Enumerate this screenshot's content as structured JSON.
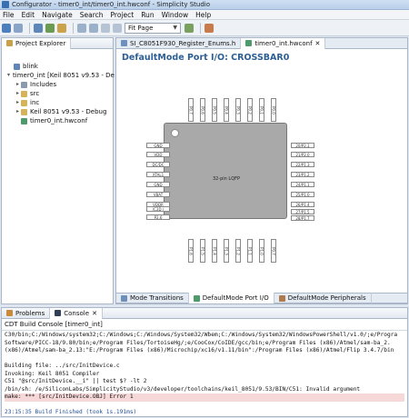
{
  "window": {
    "title": "Configurator - timer0_int/timer0_int.hwconf - Simplicity Studio"
  },
  "menu": [
    "File",
    "Edit",
    "Navigate",
    "Search",
    "Project",
    "Run",
    "Window",
    "Help"
  ],
  "toolbar": {
    "zoom_value": "Fit Page"
  },
  "project_explorer": {
    "tab_label": "Project Explorer",
    "items": [
      {
        "label": "blink",
        "level": 0,
        "expanded": false
      },
      {
        "label": "timer0_int [Keil 8051 v9.53 - De",
        "level": 0,
        "expanded": true
      },
      {
        "label": "Includes",
        "level": 1,
        "expanded": false
      },
      {
        "label": "src",
        "level": 1,
        "expanded": false
      },
      {
        "label": "inc",
        "level": 1,
        "expanded": false
      },
      {
        "label": "Keil 8051 v9.53 - Debug",
        "level": 1,
        "expanded": false
      },
      {
        "label": "timer0_int.hwconf",
        "level": 1,
        "expanded": null
      }
    ]
  },
  "editor": {
    "tabs": [
      {
        "label": "SI_C8051F930_Register_Enums.h",
        "active": false
      },
      {
        "label": "timer0_int.hwconf",
        "active": true
      }
    ],
    "title": "DefaultMode Port I/O: CROSSBAR0",
    "chip_label": "32-pin LQFP",
    "top_pins": [
      "P0.7",
      "P0.6",
      "P0.5",
      "P0.4",
      "P0.3",
      "P0.2",
      "P0.1",
      "P0.0"
    ],
    "bottom_pins": [
      "P1.6",
      "P1.5",
      "P1.4",
      "P1.3",
      "P1.2",
      "P1.1",
      "P1.0",
      "P0.7"
    ],
    "left_pins": [
      "GND",
      "VDD",
      "DC/DC",
      "XTAL1",
      "GND",
      "VBAT",
      "VDDR",
      "/C2D /",
      "P2.6"
    ],
    "right_pins": [
      "20/P2.1",
      "21/P2.0",
      "22/P1.3",
      "23/P1.2",
      "24/P1.1",
      "25/P1.0",
      "26/P1.4",
      "27/P1.5",
      "28/P1.7"
    ],
    "bottom_tabs": [
      {
        "label": "Mode Transitions",
        "active": false
      },
      {
        "label": "DefaultMode Port I/O",
        "active": true
      },
      {
        "label": "DefaultMode Peripherals",
        "active": false
      }
    ]
  },
  "console": {
    "tabs": [
      {
        "label": "Problems",
        "active": false
      },
      {
        "label": "Console",
        "active": true
      }
    ],
    "header": "CDT Build Console [timer0_int]",
    "lines": [
      {
        "text": "C30/bin;C:/Windows/system32;C:/Windows;C:/Windows/System32/Wbem;C:/Windows/System32/WindowsPowerShell/v1.0/;e/Progra",
        "error": false
      },
      {
        "text": "Software/PICC-18/9.80/bin;e/Program Files/TortoiseHg/;e/CooCox/CoIDE/gcc/bin;e/Program Files (x86)/Atmel/sam-ba_2.",
        "error": false
      },
      {
        "text": "(x86)/Atmel/sam-ba_2.13:\"E:/Program Files (x86)/Microchip/xc16/v1.11/bin\":/Program Files (x86)/Atmel/Flip 3.4.7/bin",
        "error": false
      },
      {
        "text": "",
        "error": false
      },
      {
        "text": "Building file: ../src/InitDevice.c",
        "error": false
      },
      {
        "text": "Invoking: Keil 8051 Compiler",
        "error": false
      },
      {
        "text": "C51 \"@src/InitDevice.__i\" || test $? -lt 2",
        "error": false
      },
      {
        "text": "/bin/sh: /e/SiliconLabs/SimplicityStudio/v3/developer/toolchains/keil_8051/9.53/BIN/C51: Invalid argument",
        "error": false
      },
      {
        "text": "make: *** [src/InitDevice.OBJ] Error 1",
        "error": true
      },
      {
        "text": "",
        "error": false
      },
      {
        "text": "23:15:35 Build Finished (took 1s.191ms)",
        "error": false
      }
    ]
  }
}
